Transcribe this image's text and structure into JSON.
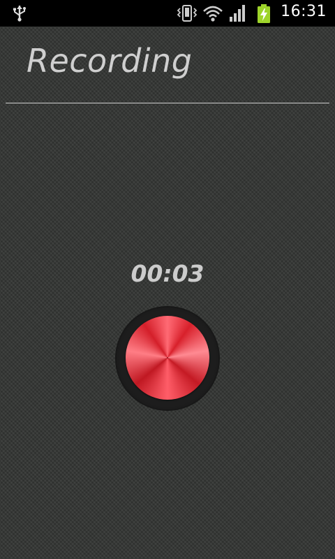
{
  "status_bar": {
    "time": "16:31",
    "icons": [
      "usb-icon",
      "vibrate-icon",
      "wifi-icon",
      "signal-icon",
      "battery-charging-icon"
    ]
  },
  "header": {
    "title": "Recording"
  },
  "recorder": {
    "elapsed": "00:03",
    "record_button_color": "#e0222d"
  }
}
